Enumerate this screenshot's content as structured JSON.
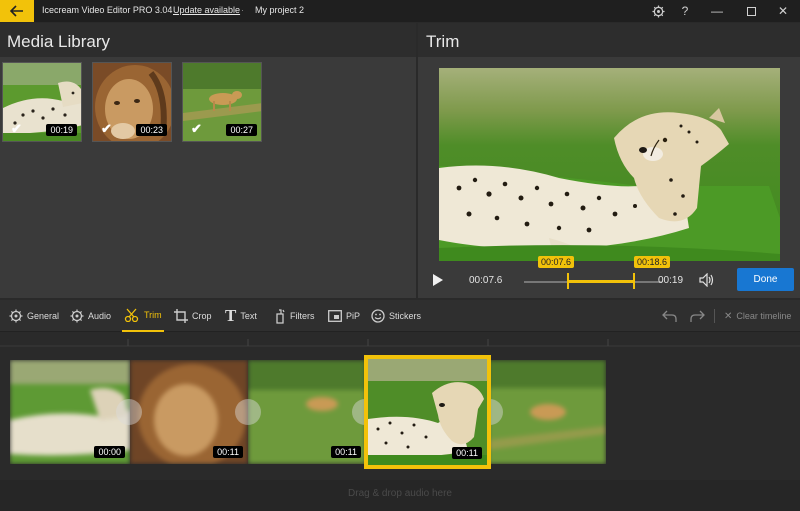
{
  "titlebar": {
    "app_title": "Icecream Video Editor PRO 3.04",
    "separator": "·",
    "update_link": "Update available",
    "project_name": "My project 2",
    "icons": [
      "back-arrow-icon",
      "settings-icon",
      "help-icon",
      "minimize-icon",
      "maximize-icon",
      "close-icon"
    ]
  },
  "media_library": {
    "title": "Media Library",
    "items": [
      {
        "label": "cheetah",
        "duration": "00:19",
        "checked": true
      },
      {
        "label": "lion",
        "duration": "00:23",
        "checked": true
      },
      {
        "label": "lioness",
        "duration": "00:27",
        "checked": true
      }
    ]
  },
  "trim": {
    "title": "Trim",
    "start_marker": "00:07.6",
    "end_marker": "00:18.6",
    "current_time": "00:07.6",
    "total_time": "00:19",
    "done_label": "Done",
    "accent_color": "#f2c20a"
  },
  "toolbar": {
    "items": [
      {
        "label": "General",
        "icon": "gear-icon"
      },
      {
        "label": "Audio",
        "icon": "gear-icon"
      },
      {
        "label": "Trim",
        "icon": "scissors-icon",
        "active": true
      },
      {
        "label": "Crop",
        "icon": "crop-icon"
      },
      {
        "label": "Text",
        "icon": "text-icon"
      },
      {
        "label": "Filters",
        "icon": "filters-icon"
      },
      {
        "label": "PiP",
        "icon": "pip-icon"
      },
      {
        "label": "Stickers",
        "icon": "sticker-icon"
      }
    ],
    "clear_timeline": "Clear timeline"
  },
  "timeline": {
    "clips": [
      {
        "name": "cheetah",
        "duration": "00:00"
      },
      {
        "name": "lion",
        "duration": "00:11"
      },
      {
        "name": "lioness",
        "duration": "00:11"
      },
      {
        "name": "cheetah",
        "duration": "00:11",
        "active": true
      },
      {
        "name": "lioness",
        "duration": ""
      }
    ],
    "audio_placeholder": "Drag & drop audio here"
  }
}
